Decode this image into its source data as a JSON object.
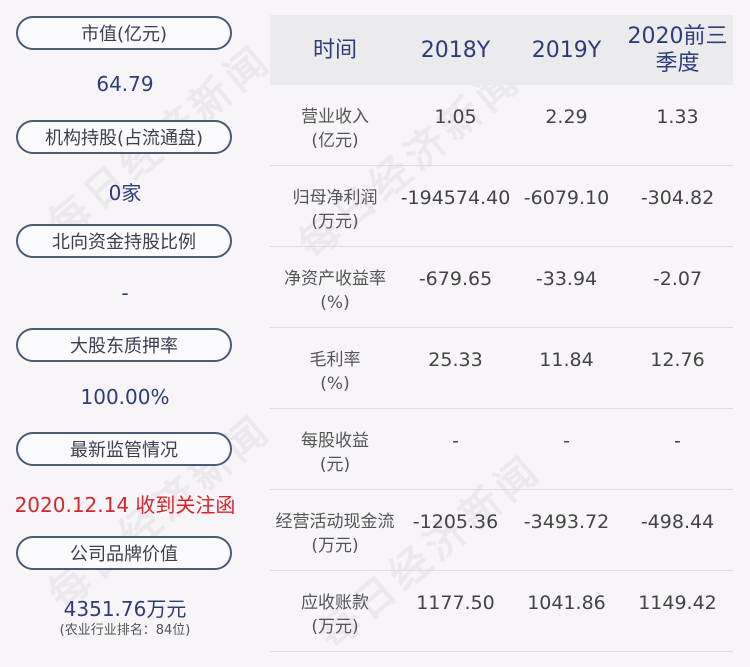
{
  "left_panel": {
    "items": [
      {
        "label": "市值(亿元)",
        "value": "64.79"
      },
      {
        "label": "机构持股(占流通盘)",
        "value": "0家"
      },
      {
        "label": "北向资金持股比例",
        "value": "-"
      },
      {
        "label": "大股东质押率",
        "value": "100.00%"
      },
      {
        "label": "最新监管情况",
        "value": "2020.12.14 收到关注函"
      },
      {
        "label": "公司品牌价值",
        "value": "4351.76万元",
        "note": "(农业行业排名：84位)"
      }
    ]
  },
  "table": {
    "headers": [
      "时间",
      "2018Y",
      "2019Y",
      "2020前三季度"
    ],
    "rows": [
      {
        "metric": "营业收入",
        "unit": "(亿元)",
        "values": [
          "1.05",
          "2.29",
          "1.33"
        ]
      },
      {
        "metric": "归母净利润",
        "unit": "(万元)",
        "values": [
          "-194574.40",
          "-6079.10",
          "-304.82"
        ]
      },
      {
        "metric": "净资产收益率",
        "unit": "(%)",
        "values": [
          "-679.65",
          "-33.94",
          "-2.07"
        ]
      },
      {
        "metric": "毛利率",
        "unit": "(%)",
        "values": [
          "25.33",
          "11.84",
          "12.76"
        ]
      },
      {
        "metric": "每股收益",
        "unit": "(元)",
        "values": [
          "-",
          "-",
          "-"
        ]
      },
      {
        "metric": "经营活动现金流",
        "unit": "(万元)",
        "values": [
          "-1205.36",
          "-3493.72",
          "-498.44"
        ]
      },
      {
        "metric": "应收账款",
        "unit": "(万元)",
        "values": [
          "1177.50",
          "1041.86",
          "1149.42"
        ]
      }
    ]
  },
  "watermark": "每日经济新闻",
  "colors": {
    "value_blue": "#2d3d7a",
    "alert_red": "#d6262b",
    "pill_border": "#4d5a74"
  }
}
